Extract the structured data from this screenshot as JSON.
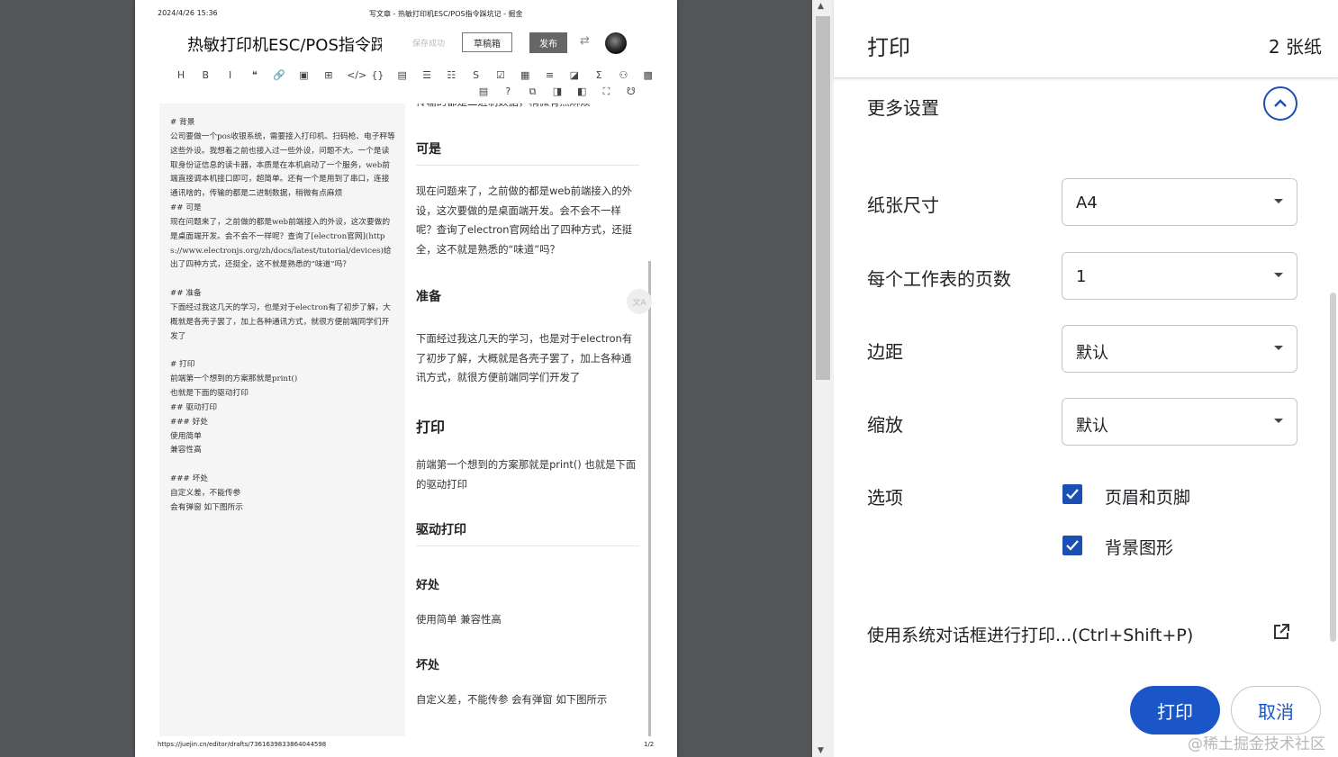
{
  "preview": {
    "header_datetime": "2024/4/26 15:36",
    "header_title": "写文章 - 热敏打印机ESC/POS指令踩坑记 - 掘金",
    "editor": {
      "title": "热敏打印机ESC/POS指令踩",
      "save_status": "保存成功",
      "draft_label": "草稿箱",
      "publish_label": "发布",
      "swap_icon": "⇄"
    },
    "toolbar_row1": [
      "H",
      "B",
      "I",
      "❝",
      "🔗",
      "▣",
      "⊞",
      "</>",
      "{}",
      "▤",
      "☰",
      "☷",
      "S",
      "☑",
      "▦",
      "≡",
      "◪",
      "Σ",
      "⚇",
      "▩"
    ],
    "toolbar_row2": [
      "▤",
      "?",
      "⧉",
      "◨",
      "◧",
      "⛶",
      "☋"
    ],
    "markdown_text": "# 背景\n公司要做一个pos收银系统，需要接入打印机、扫码枪、电子秤等这些外设。我想着之前也接入过一些外设，问题不大。一个是读取身份证信息的读卡器，本质是在本机启动了一个服务，web前端直接调本机接口即可，超简单。还有一个是用到了串口，连接通讯啥的，传输的都是二进制数据，稍微有点麻烦\n## 可是\n现在问题来了，之前做的都是web前端接入的外设，这次要做的是桌面端开发。会不会不一样呢？查询了[electron官网](https://www.electronjs.org/zh/docs/latest/tutorial/devices)给出了四种方式，还挺全，这不就是熟悉的“味道”吗？\n\n## 准备\n下面经过我这几天的学习，也是对于electron有了初步了解，大概就是各壳子罢了，加上各种通讯方式，就很方便前端同学们开发了\n\n# 打印\n前端第一个想到的方案那就是print()\n也就是下面的驱动打印\n## 驱动打印\n### 好处\n使用简单\n兼容性高\n\n### 坏处\n自定义差，不能传参\n会有弹窗 如下图所示",
    "rendered": {
      "top_cut": "传输的都是二进制数据，稍微有点麻烦",
      "h_keshi": "可是",
      "p_keshi": "现在问题来了，之前做的都是web前端接入的外设，这次要做的是桌面端开发。会不会不一样呢？查询了electron官网给出了四种方式，还挺全，这不就是熟悉的“味道”吗？",
      "h_zhunbei": "准备",
      "p_zhunbei": "下面经过我这几天的学习，也是对于electron有了初步了解，大概就是各壳子罢了，加上各种通讯方式，就很方便前端同学们开发了",
      "h_dayin": "打印",
      "p_dayin": "前端第一个想到的方案那就是print() 也就是下面的驱动打印",
      "h_qudong": "驱动打印",
      "h_haochu": "好处",
      "p_haochu": "使用简单 兼容性高",
      "h_huaichu": "坏处",
      "p_huaichu": "自定义差，不能传参 会有弹窗 如下图所示"
    },
    "footer_url": "https://juejin.cn/editor/drafts/7361639833864044598",
    "footer_page": "1/2"
  },
  "panel": {
    "title": "打印",
    "sheet_count": "2 张纸",
    "more_settings": "更多设置",
    "paper_size_label": "纸张尺寸",
    "paper_size_value": "A4",
    "pages_per_sheet_label": "每个工作表的页数",
    "pages_per_sheet_value": "1",
    "margins_label": "边距",
    "margins_value": "默认",
    "scale_label": "缩放",
    "scale_value": "默认",
    "options_label": "选项",
    "opt_headers_footers": "页眉和页脚",
    "opt_headers_footers_checked": true,
    "opt_background": "背景图形",
    "opt_background_checked": true,
    "system_dialog": "使用系统对话框进行打印...(Ctrl+Shift+P)",
    "print_button": "打印",
    "cancel_button": "取消",
    "accent_color": "#1a56c8"
  },
  "watermark": "@稀土掘金技术社区"
}
